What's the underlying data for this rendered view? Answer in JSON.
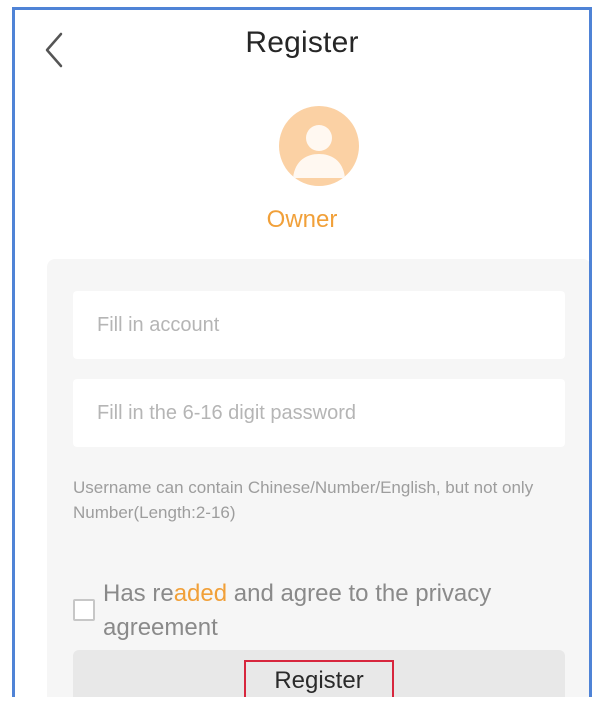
{
  "header": {
    "title": "Register",
    "back_icon": "chevron-left-icon"
  },
  "profile": {
    "avatar_icon": "user-avatar-icon",
    "role": "Owner"
  },
  "form": {
    "account_placeholder": "Fill in account",
    "password_placeholder": "Fill in the 6-16 digit password",
    "hint": "Username can contain Chinese/Number/English, but not only Number(Length:2-16)",
    "agreement": {
      "prefix": "Has re",
      "link": "aded",
      "suffix": " and agree to the privacy agreement"
    },
    "register_label": "Register"
  },
  "colors": {
    "accent": "#f1a039",
    "frame_border": "#4f83d6",
    "avatar_bg": "#fbd1a4",
    "highlight_box": "#d7263d"
  }
}
